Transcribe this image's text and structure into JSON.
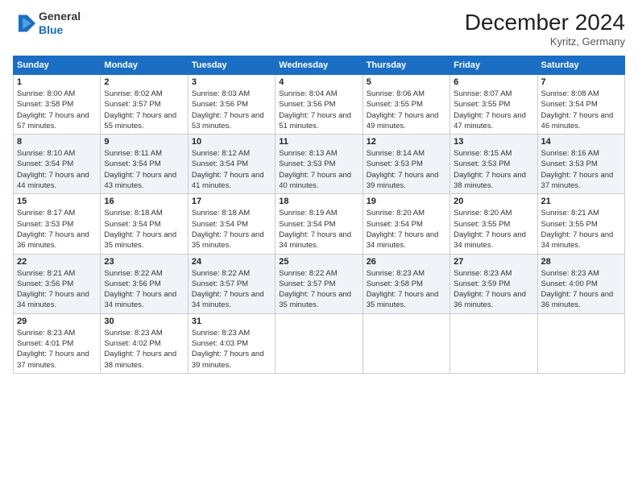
{
  "header": {
    "logo": {
      "general": "General",
      "blue": "Blue"
    },
    "title": "December 2024",
    "location": "Kyritz, Germany"
  },
  "calendar": {
    "days_of_week": [
      "Sunday",
      "Monday",
      "Tuesday",
      "Wednesday",
      "Thursday",
      "Friday",
      "Saturday"
    ],
    "weeks": [
      [
        {
          "day": "1",
          "sunrise": "Sunrise: 8:00 AM",
          "sunset": "Sunset: 3:58 PM",
          "daylight": "Daylight: 7 hours and 57 minutes."
        },
        {
          "day": "2",
          "sunrise": "Sunrise: 8:02 AM",
          "sunset": "Sunset: 3:57 PM",
          "daylight": "Daylight: 7 hours and 55 minutes."
        },
        {
          "day": "3",
          "sunrise": "Sunrise: 8:03 AM",
          "sunset": "Sunset: 3:56 PM",
          "daylight": "Daylight: 7 hours and 53 minutes."
        },
        {
          "day": "4",
          "sunrise": "Sunrise: 8:04 AM",
          "sunset": "Sunset: 3:56 PM",
          "daylight": "Daylight: 7 hours and 51 minutes."
        },
        {
          "day": "5",
          "sunrise": "Sunrise: 8:06 AM",
          "sunset": "Sunset: 3:55 PM",
          "daylight": "Daylight: 7 hours and 49 minutes."
        },
        {
          "day": "6",
          "sunrise": "Sunrise: 8:07 AM",
          "sunset": "Sunset: 3:55 PM",
          "daylight": "Daylight: 7 hours and 47 minutes."
        },
        {
          "day": "7",
          "sunrise": "Sunrise: 8:08 AM",
          "sunset": "Sunset: 3:54 PM",
          "daylight": "Daylight: 7 hours and 46 minutes."
        }
      ],
      [
        {
          "day": "8",
          "sunrise": "Sunrise: 8:10 AM",
          "sunset": "Sunset: 3:54 PM",
          "daylight": "Daylight: 7 hours and 44 minutes."
        },
        {
          "day": "9",
          "sunrise": "Sunrise: 8:11 AM",
          "sunset": "Sunset: 3:54 PM",
          "daylight": "Daylight: 7 hours and 43 minutes."
        },
        {
          "day": "10",
          "sunrise": "Sunrise: 8:12 AM",
          "sunset": "Sunset: 3:54 PM",
          "daylight": "Daylight: 7 hours and 41 minutes."
        },
        {
          "day": "11",
          "sunrise": "Sunrise: 8:13 AM",
          "sunset": "Sunset: 3:53 PM",
          "daylight": "Daylight: 7 hours and 40 minutes."
        },
        {
          "day": "12",
          "sunrise": "Sunrise: 8:14 AM",
          "sunset": "Sunset: 3:53 PM",
          "daylight": "Daylight: 7 hours and 39 minutes."
        },
        {
          "day": "13",
          "sunrise": "Sunrise: 8:15 AM",
          "sunset": "Sunset: 3:53 PM",
          "daylight": "Daylight: 7 hours and 38 minutes."
        },
        {
          "day": "14",
          "sunrise": "Sunrise: 8:16 AM",
          "sunset": "Sunset: 3:53 PM",
          "daylight": "Daylight: 7 hours and 37 minutes."
        }
      ],
      [
        {
          "day": "15",
          "sunrise": "Sunrise: 8:17 AM",
          "sunset": "Sunset: 3:53 PM",
          "daylight": "Daylight: 7 hours and 36 minutes."
        },
        {
          "day": "16",
          "sunrise": "Sunrise: 8:18 AM",
          "sunset": "Sunset: 3:54 PM",
          "daylight": "Daylight: 7 hours and 35 minutes."
        },
        {
          "day": "17",
          "sunrise": "Sunrise: 8:18 AM",
          "sunset": "Sunset: 3:54 PM",
          "daylight": "Daylight: 7 hours and 35 minutes."
        },
        {
          "day": "18",
          "sunrise": "Sunrise: 8:19 AM",
          "sunset": "Sunset: 3:54 PM",
          "daylight": "Daylight: 7 hours and 34 minutes."
        },
        {
          "day": "19",
          "sunrise": "Sunrise: 8:20 AM",
          "sunset": "Sunset: 3:54 PM",
          "daylight": "Daylight: 7 hours and 34 minutes."
        },
        {
          "day": "20",
          "sunrise": "Sunrise: 8:20 AM",
          "sunset": "Sunset: 3:55 PM",
          "daylight": "Daylight: 7 hours and 34 minutes."
        },
        {
          "day": "21",
          "sunrise": "Sunrise: 8:21 AM",
          "sunset": "Sunset: 3:55 PM",
          "daylight": "Daylight: 7 hours and 34 minutes."
        }
      ],
      [
        {
          "day": "22",
          "sunrise": "Sunrise: 8:21 AM",
          "sunset": "Sunset: 3:56 PM",
          "daylight": "Daylight: 7 hours and 34 minutes."
        },
        {
          "day": "23",
          "sunrise": "Sunrise: 8:22 AM",
          "sunset": "Sunset: 3:56 PM",
          "daylight": "Daylight: 7 hours and 34 minutes."
        },
        {
          "day": "24",
          "sunrise": "Sunrise: 8:22 AM",
          "sunset": "Sunset: 3:57 PM",
          "daylight": "Daylight: 7 hours and 34 minutes."
        },
        {
          "day": "25",
          "sunrise": "Sunrise: 8:22 AM",
          "sunset": "Sunset: 3:57 PM",
          "daylight": "Daylight: 7 hours and 35 minutes."
        },
        {
          "day": "26",
          "sunrise": "Sunrise: 8:23 AM",
          "sunset": "Sunset: 3:58 PM",
          "daylight": "Daylight: 7 hours and 35 minutes."
        },
        {
          "day": "27",
          "sunrise": "Sunrise: 8:23 AM",
          "sunset": "Sunset: 3:59 PM",
          "daylight": "Daylight: 7 hours and 36 minutes."
        },
        {
          "day": "28",
          "sunrise": "Sunrise: 8:23 AM",
          "sunset": "Sunset: 4:00 PM",
          "daylight": "Daylight: 7 hours and 36 minutes."
        }
      ],
      [
        {
          "day": "29",
          "sunrise": "Sunrise: 8:23 AM",
          "sunset": "Sunset: 4:01 PM",
          "daylight": "Daylight: 7 hours and 37 minutes."
        },
        {
          "day": "30",
          "sunrise": "Sunrise: 8:23 AM",
          "sunset": "Sunset: 4:02 PM",
          "daylight": "Daylight: 7 hours and 38 minutes."
        },
        {
          "day": "31",
          "sunrise": "Sunrise: 8:23 AM",
          "sunset": "Sunset: 4:03 PM",
          "daylight": "Daylight: 7 hours and 39 minutes."
        },
        null,
        null,
        null,
        null
      ]
    ]
  }
}
